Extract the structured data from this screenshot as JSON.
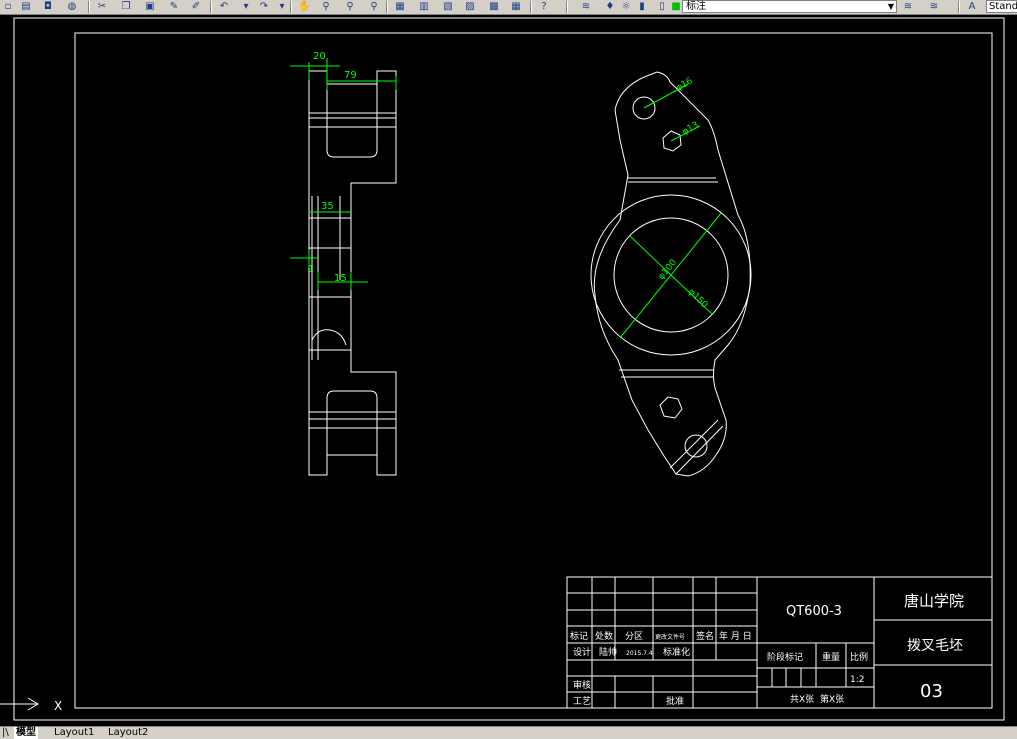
{
  "toolbar": {
    "layer_name": "标注",
    "text_style": "Standard",
    "icons": [
      "new-icon",
      "open-icon",
      "save-icon",
      "plot-icon",
      "cut-icon",
      "copy-icon",
      "paste-icon",
      "match-icon",
      "undo-icon",
      "redo-icon",
      "pan-icon",
      "zoom-icon",
      "zoom-window-icon",
      "zoom-previous-icon",
      "properties-icon",
      "designcenter-icon",
      "toolpalette-icon",
      "sheetset-icon",
      "markup-icon",
      "calc-icon",
      "help-icon",
      "layer-icon",
      "lightbulb-icon",
      "sun-icon",
      "lock-icon",
      "color-icon"
    ]
  },
  "drawing": {
    "dims_side": {
      "d20": "20",
      "d79": "79",
      "d35": "35",
      "d1": "1",
      "d15": "15"
    },
    "dims_front": {
      "phi16": "φ16",
      "phi13": "φ13",
      "phi100": "φ100",
      "phi150": "φ150"
    },
    "ucs_x": "X"
  },
  "title_block": {
    "material": "QT600-3",
    "school": "唐山学院",
    "part_name": "拨叉毛坯",
    "drawing_no": "03",
    "row_header": [
      "标记",
      "处数",
      "分区",
      "更改文件号",
      "签名",
      "年 月 日"
    ],
    "row_design": [
      "设计",
      "陆帅",
      "2015.7.4",
      "标准化"
    ],
    "stage_labels": [
      "阶段标记",
      "重量",
      "比例"
    ],
    "scale": "1:2",
    "review": "审核",
    "process": "工艺",
    "approve": "批准",
    "sheets_total": "共X张",
    "sheet_no": "第X张"
  },
  "tabs": [
    "模型",
    "Layout1",
    "Layout2"
  ],
  "colors": {
    "drawing_line": "#ffffff",
    "dimension": "#00ff00",
    "background": "#000000",
    "ui_gray": "#d4d0c8"
  }
}
